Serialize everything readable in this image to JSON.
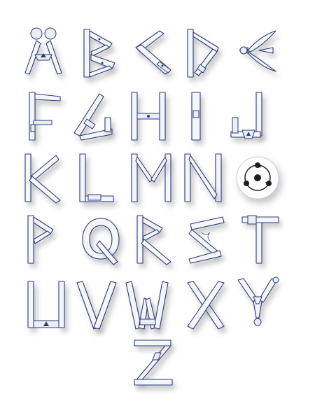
{
  "artwork": {
    "style": "ninja-weapon alphabet (kunai, swords, shuriken, sharingan)",
    "stroke_color": "#2c3a78",
    "blade_fill": "#f4f6fa",
    "background": "#ffffff",
    "letters": [
      {
        "char": "A",
        "weapon": "scissors-kunai"
      },
      {
        "char": "B",
        "weapon": "swords"
      },
      {
        "char": "C",
        "weapon": "swords"
      },
      {
        "char": "D",
        "weapon": "swords"
      },
      {
        "char": "E",
        "weapon": "kunai"
      },
      {
        "char": "F",
        "weapon": "swords"
      },
      {
        "char": "G",
        "weapon": "swords"
      },
      {
        "char": "H",
        "weapon": "swords"
      },
      {
        "char": "I",
        "weapon": "sword"
      },
      {
        "char": "J",
        "weapon": "swords"
      },
      {
        "char": "K",
        "weapon": "swords"
      },
      {
        "char": "L",
        "weapon": "swords"
      },
      {
        "char": "M",
        "weapon": "swords"
      },
      {
        "char": "N",
        "weapon": "swords"
      },
      {
        "char": "O",
        "weapon": "sharingan"
      },
      {
        "char": "P",
        "weapon": "swords"
      },
      {
        "char": "Q",
        "weapon": "swords"
      },
      {
        "char": "R",
        "weapon": "swords"
      },
      {
        "char": "S",
        "weapon": "swords"
      },
      {
        "char": "T",
        "weapon": "swords"
      },
      {
        "char": "U",
        "weapon": "swords"
      },
      {
        "char": "V",
        "weapon": "swords"
      },
      {
        "char": "W",
        "weapon": "swords"
      },
      {
        "char": "X",
        "weapon": "swords"
      },
      {
        "char": "Y",
        "weapon": "kunai"
      },
      {
        "char": "Z",
        "weapon": "swords"
      }
    ]
  }
}
